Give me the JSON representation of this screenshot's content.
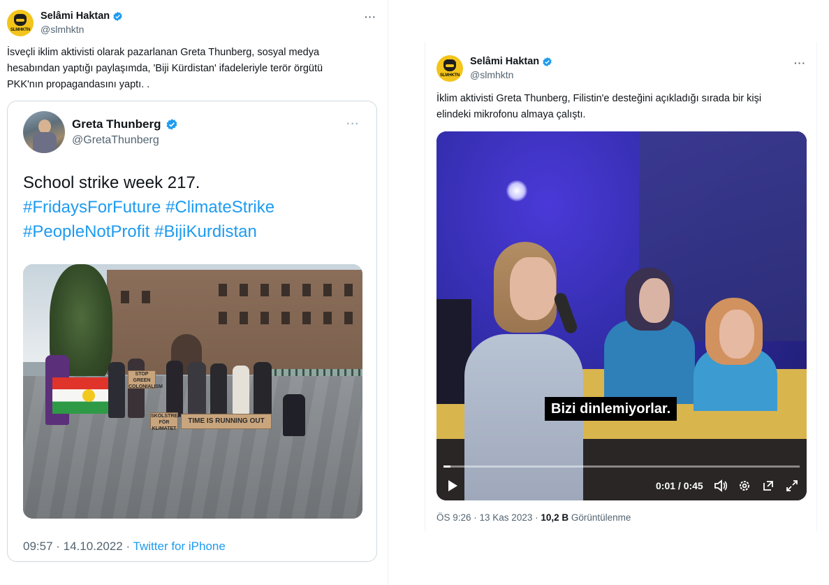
{
  "left_tweet": {
    "author": {
      "name": "Selâmi Haktan",
      "handle": "@slmhktn",
      "avatar_text": "SLMHKTN"
    },
    "more": "···",
    "text_lines": [
      "İsveçli iklim aktivisti  olarak pazarlanan Greta Thunberg, sosyal medya",
      "hesabından yaptığı paylaşımda, 'Biji Kürdistan' ifadeleriyle terör örgütü",
      "PKK'nın propagandasını yaptı. ."
    ],
    "embed": {
      "name": "Greta Thunberg",
      "handle": "@GretaThunberg",
      "more": "···",
      "text": {
        "line1": "School strike week 217.",
        "line2_tags": [
          "#FridaysForFuture",
          "#ClimateStrike"
        ],
        "line3_tags": [
          "#PeopleNotProfit",
          "#BijiKurdistan"
        ]
      },
      "photo_icon": "protest-photo",
      "signs": [
        "STOP GREEN COLONIALISM",
        "SKOLSTREJK FÖR KLIMATET",
        "TIME IS RUNNING OUT"
      ],
      "footer": {
        "time": "09:57 · 14.10.2022 · ",
        "source": "Twitter for iPhone"
      }
    }
  },
  "right_tweet": {
    "author": {
      "name": "Selâmi Haktan",
      "handle": "@slmhktn",
      "avatar_text": "SLMHKTN"
    },
    "more": "···",
    "text_lines": [
      "İklim aktivisti Greta Thunberg, Filistin'e desteğini açıkladığı sırada bir kişi",
      "elindeki mikrofonu almaya çalıştı."
    ],
    "video": {
      "subtitle": "Bizi dinlemiyorlar.",
      "time": "0:01 / 0:45",
      "progress": 0.02,
      "controls": [
        "play-icon",
        "volume-icon",
        "settings-icon",
        "pip-icon",
        "fullscreen-icon"
      ]
    },
    "meta": {
      "time": "ÖS 9:26 · 13 Kas 2023 · ",
      "views": "10,2 B",
      "views_label": " Görüntülenme"
    }
  },
  "colors": {
    "link": "#1d9bf0",
    "verified": "#1d9bf0",
    "muted": "#536471",
    "avatar_bg": "#f3c41b"
  }
}
